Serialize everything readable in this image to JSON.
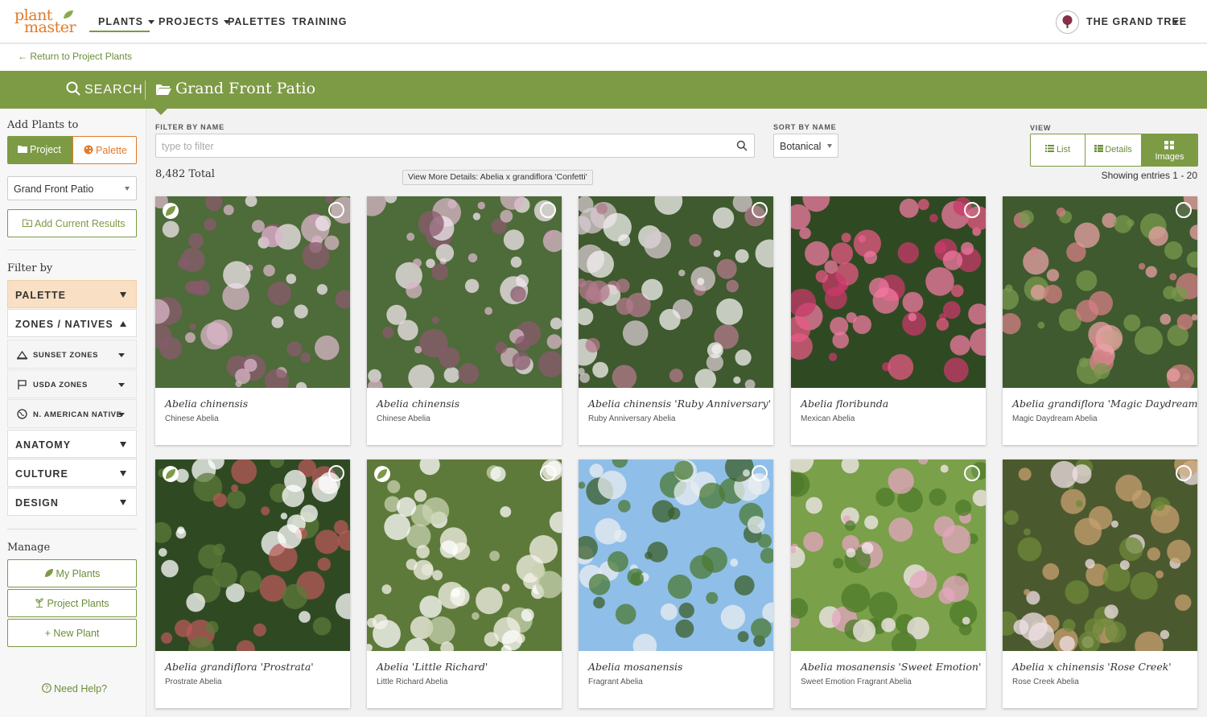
{
  "logo": {
    "line1": "plant",
    "line2": "master"
  },
  "nav": {
    "plants": "PLANTS",
    "projects": "PROJECTS",
    "palettes": "PALETTES",
    "training": "TRAINING",
    "account": "THE GRAND TREE"
  },
  "return_link": "← Return to Project Plants",
  "header": {
    "search": "SEARCH",
    "project_title": "Grand Front Patio"
  },
  "sidebar": {
    "add_plants_to": "Add Plants to",
    "project_btn": "Project",
    "palette_btn": "Palette",
    "selected_project": "Grand Front Patio",
    "add_current_results": "Add Current Results",
    "filter_by": "Filter by",
    "filters": {
      "palette": "PALETTE",
      "zones_natives": "ZONES / NATIVES",
      "sunset_zones": "SUNSET ZONES",
      "usda_zones": "USDA ZONES",
      "n_american_native": "N. AMERICAN NATIVE",
      "anatomy": "ANATOMY",
      "culture": "CULTURE",
      "design": "DESIGN"
    },
    "manage": "Manage",
    "my_plants": "My Plants",
    "project_plants": "Project Plants",
    "new_plant": "+ New Plant",
    "need_help": "Need Help?"
  },
  "toolbar": {
    "filter_label": "FILTER BY NAME",
    "filter_placeholder": "type to filter",
    "sort_label": "SORT BY NAME",
    "sort_value": "Botanical",
    "view_label": "VIEW",
    "view_list": "List",
    "view_details": "Details",
    "view_images": "Images",
    "total": "8,482 Total",
    "tooltip": "View More Details: Abelia x grandiflora 'Confetti'",
    "entries": "Showing entries 1 - 20"
  },
  "plants": [
    {
      "name": "Abelia chinensis",
      "common": "Chinese Abelia",
      "native": true
    },
    {
      "name": "Abelia chinensis",
      "common": "Chinese Abelia",
      "native": false
    },
    {
      "name": "Abelia chinensis 'Ruby Anniversary'",
      "common": "Ruby Anniversary Abelia",
      "native": false
    },
    {
      "name": "Abelia floribunda",
      "common": "Mexican Abelia",
      "native": false
    },
    {
      "name": "Abelia grandiflora 'Magic Daydream'",
      "common": "Magic Daydream Abelia",
      "native": false
    },
    {
      "name": "Abelia grandiflora 'Prostrata'",
      "common": "Prostrate Abelia",
      "native": true
    },
    {
      "name": "Abelia 'Little Richard'",
      "common": "Little Richard Abelia",
      "native": true
    },
    {
      "name": "Abelia mosanensis",
      "common": "Fragrant Abelia",
      "native": false
    },
    {
      "name": "Abelia mosanensis 'Sweet Emotion'",
      "common": "Sweet Emotion Fragrant Abelia",
      "native": false
    },
    {
      "name": "Abelia x chinensis 'Rose Creek'",
      "common": "Rose Creek Abelia",
      "native": false
    }
  ],
  "colors": {
    "brand_green": "#7d9a45",
    "brand_orange": "#e07b2a",
    "palette_highlight": "#f9dfc3"
  }
}
